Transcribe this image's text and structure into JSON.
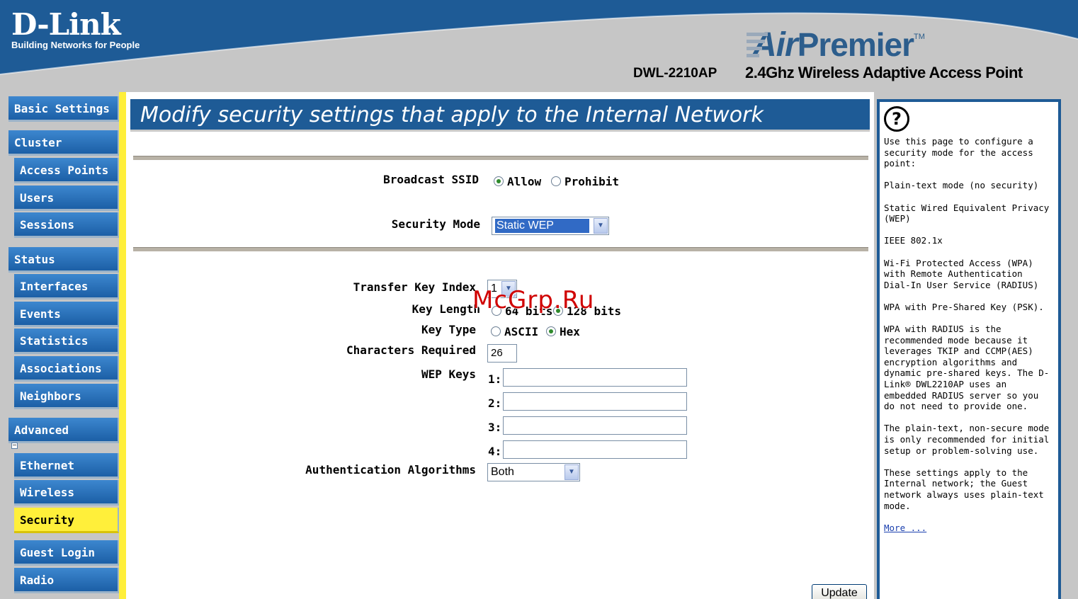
{
  "header": {
    "logo": "D-Link",
    "logo_tagline": "Building Networks for People",
    "brand_air": "Air",
    "brand_premier": "Premier",
    "brand_tm": "TM",
    "model": "DWL-2210AP",
    "product": "2.4Ghz Wireless Adaptive Access Point"
  },
  "colors": {
    "nav_blue": "#1c5fa6",
    "title_blue": "#1e5b96",
    "accent_yellow": "#ffef3a",
    "frame_gray": "#c6c6c6"
  },
  "sidebar": {
    "items": [
      {
        "label": "Basic Settings"
      },
      {
        "label": "Cluster"
      },
      {
        "label": "Access Points"
      },
      {
        "label": "Users"
      },
      {
        "label": "Sessions"
      },
      {
        "label": "Status"
      },
      {
        "label": "Interfaces"
      },
      {
        "label": "Events"
      },
      {
        "label": "Statistics"
      },
      {
        "label": "Associations"
      },
      {
        "label": "Neighbors"
      },
      {
        "label": "Advanced"
      },
      {
        "label": "Ethernet"
      },
      {
        "label": "Wireless"
      },
      {
        "label": "Security"
      },
      {
        "label": "Guest Login"
      },
      {
        "label": "Radio"
      }
    ],
    "active": "Security",
    "collapse_glyph": "−"
  },
  "main": {
    "title": "Modify security settings that apply to the Internal Network",
    "broadcast_ssid": {
      "label": "Broadcast SSID",
      "options": [
        "Allow",
        "Prohibit"
      ],
      "selected": "Allow"
    },
    "security_mode": {
      "label": "Security Mode",
      "value": "Static WEP"
    },
    "transfer_key_index": {
      "label": "Transfer Key Index",
      "value": "1"
    },
    "key_length": {
      "label": "Key Length",
      "options": [
        "64 bits",
        "128 bits"
      ],
      "selected": "128 bits"
    },
    "key_type": {
      "label": "Key Type",
      "options": [
        "ASCII",
        "Hex"
      ],
      "selected": "Hex"
    },
    "characters_required": {
      "label": "Characters Required",
      "value": "26"
    },
    "wep_keys": {
      "label": "WEP Keys",
      "keys": [
        {
          "num": "1:",
          "value": ""
        },
        {
          "num": "2:",
          "value": ""
        },
        {
          "num": "3:",
          "value": ""
        },
        {
          "num": "4:",
          "value": ""
        }
      ]
    },
    "auth_algorithms": {
      "label": "Authentication Algorithms",
      "value": "Both"
    },
    "update_label": "Update"
  },
  "help": {
    "paragraphs": [
      "Use this page to configure a security mode for the access point:",
      "Plain-text mode (no security)",
      "Static Wired Equivalent Privacy (WEP)",
      "IEEE 802.1x",
      "Wi-Fi Protected Access (WPA) with Remote Authentication Dial-In User Service (RADIUS)",
      "WPA with Pre-Shared Key (PSK).",
      "WPA with RADIUS is the recommended mode because it leverages TKIP and CCMP(AES) encryption algorithms and dynamic pre-shared keys. The D-Link® DWL2210AP uses an embedded RADIUS server so you do not need to provide one.",
      "The plain-text, non-secure mode is only recommended for initial setup or problem-solving use.",
      "These settings apply to the Internal network; the Guest network always uses plain-text mode."
    ],
    "more_link": "More ..."
  },
  "watermark": "McGrp.Ru"
}
